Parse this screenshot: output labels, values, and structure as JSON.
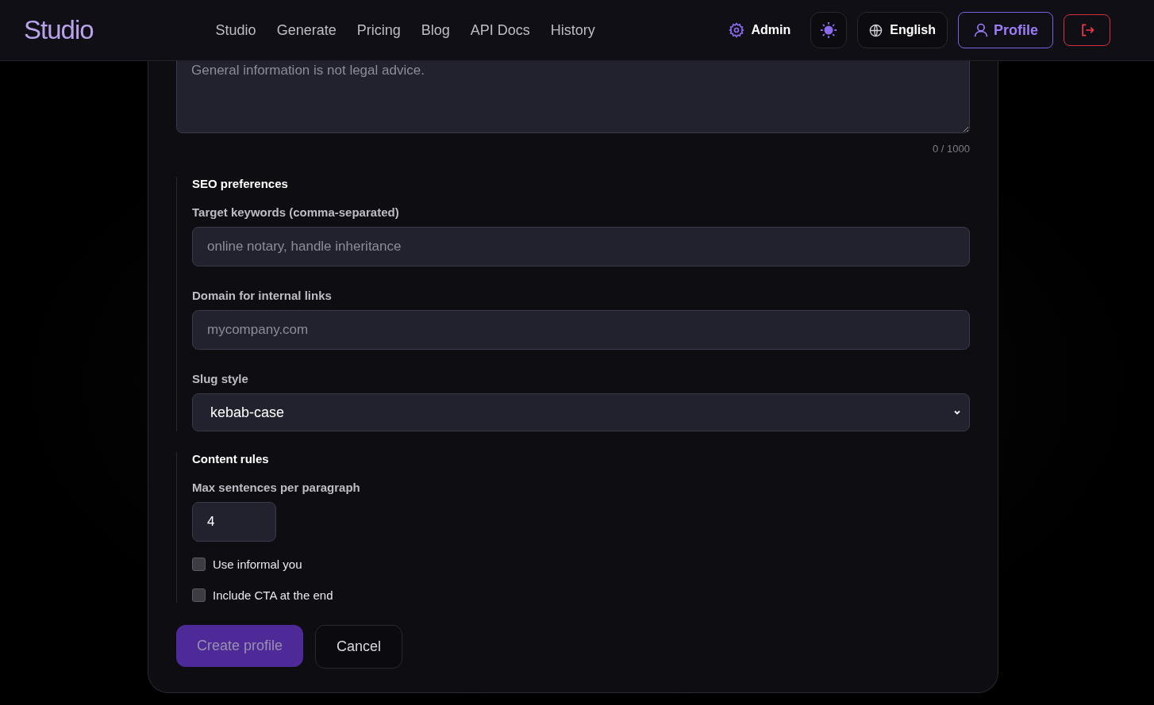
{
  "header": {
    "logo": "Studio",
    "nav": [
      {
        "label": "Studio"
      },
      {
        "label": "Generate"
      },
      {
        "label": "Pricing"
      },
      {
        "label": "Blog"
      },
      {
        "label": "API Docs"
      },
      {
        "label": "History"
      }
    ],
    "admin": "Admin",
    "language": "English",
    "profile": "Profile"
  },
  "disclaimer": {
    "placeholder": "General information is not legal advice.",
    "counter": "0 / 1000"
  },
  "sections": [
    {
      "title": "SEO preferences",
      "fields": [
        {
          "kind": "text",
          "label": "Target keywords (comma-separated)",
          "placeholder": "online notary, handle inheritance"
        },
        {
          "kind": "text",
          "label": "Domain for internal links",
          "placeholder": "mycompany.com"
        },
        {
          "kind": "select",
          "label": "Slug style",
          "value": "kebab-case"
        }
      ]
    },
    {
      "title": "Content rules",
      "fields": [
        {
          "kind": "number",
          "label": "Max sentences per paragraph",
          "value": "4"
        },
        {
          "kind": "checkbox",
          "label": "Use informal you",
          "checked": false
        },
        {
          "kind": "checkbox",
          "label": "Include CTA at the end",
          "checked": false
        }
      ]
    }
  ],
  "actions": {
    "submit": {
      "label": "Create profile",
      "disabled": true
    },
    "cancel": {
      "label": "Cancel"
    }
  }
}
